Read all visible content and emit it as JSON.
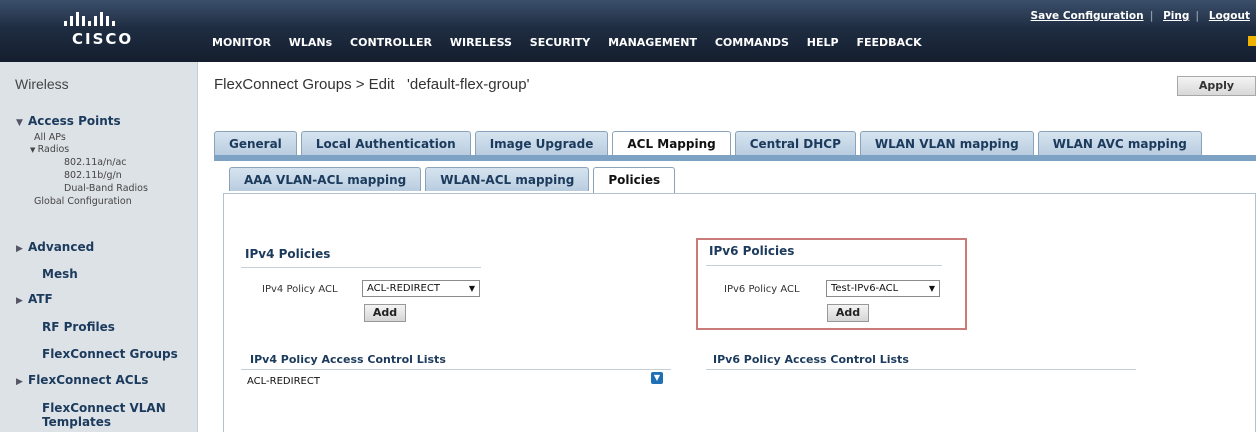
{
  "header": {
    "logo_text": "CISCO",
    "top_links": [
      "Save Configuration",
      "Ping",
      "Logout"
    ],
    "nav": [
      "MONITOR",
      "WLANs",
      "CONTROLLER",
      "WIRELESS",
      "SECURITY",
      "MANAGEMENT",
      "COMMANDS",
      "HELP",
      "FEEDBACK"
    ],
    "home_icon": "home-icon"
  },
  "sidebar": {
    "title": "Wireless",
    "access_points": {
      "label": "Access Points",
      "all_aps": "All APs",
      "radios": "Radios",
      "radio_items": [
        "802.11a/n/ac",
        "802.11b/g/n",
        "Dual-Band Radios"
      ],
      "global_config": "Global Configuration"
    },
    "items": [
      "Advanced",
      "Mesh",
      "ATF",
      "RF Profiles",
      "FlexConnect Groups",
      "FlexConnect ACLs",
      "FlexConnect VLAN Templates"
    ]
  },
  "page": {
    "title": "FlexConnect Groups > Edit   'default-flex-group'",
    "apply_label": "Apply"
  },
  "tabs": {
    "primary": [
      "General",
      "Local Authentication",
      "Image Upgrade",
      "ACL Mapping",
      "Central DHCP",
      "WLAN VLAN mapping",
      "WLAN AVC mapping"
    ],
    "primary_active": "ACL Mapping",
    "secondary": [
      "AAA VLAN-ACL mapping",
      "WLAN-ACL mapping",
      "Policies"
    ],
    "secondary_active": "Policies"
  },
  "ipv4": {
    "title": "IPv4 Policies",
    "label": "IPv4 Policy ACL",
    "selected": "ACL-REDIRECT",
    "add_label": "Add",
    "list_title": "IPv4 Policy Access Control Lists",
    "list_items": [
      "ACL-REDIRECT"
    ]
  },
  "ipv6": {
    "title": "IPv6 Policies",
    "label": "IPv6 Policy ACL",
    "selected": "Test-IPv6-ACL",
    "add_label": "Add",
    "list_title": "IPv6 Policy Access Control Lists"
  },
  "colors": {
    "header_bg": "#1f2d42",
    "tab_active_bg": "#ffffff",
    "tab_bg": "#c8d8e8",
    "highlight_box": "#c97b78",
    "link_blue": "#1b3a5c"
  }
}
